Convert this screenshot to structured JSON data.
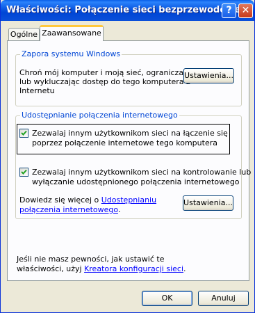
{
  "window": {
    "title": "Właściwości: Połączenie sieci bezprzewodowej",
    "help_glyph": "?",
    "close_glyph": "✕"
  },
  "tabs": [
    {
      "label": "Ogólne",
      "active": false
    },
    {
      "label": "Zaawansowane",
      "active": true
    }
  ],
  "firewall": {
    "group_label": "Zapora systemu Windows",
    "description_lines": [
      "Chroń mój komputer i moją sieć, ograniczając",
      "lub wykluczając dostęp do tego komputera z",
      "Internetu"
    ],
    "settings_button": "Ustawienia..."
  },
  "ics": {
    "group_label": "Udostępnianie połączenia internetowego",
    "option1": {
      "checked": true,
      "lines": [
        "Zezwalaj innym użytkownikom sieci na łączenie się",
        "poprzez połączenie internetowe tego komputera"
      ]
    },
    "option2": {
      "checked": true,
      "lines": [
        "Zezwalaj innym użytkownikom sieci na kontrolowanie lub",
        "wyłączanie udostępnionego połączenia internetowego"
      ]
    },
    "learn_more_prefix": "Dowiedz się więcej o ",
    "learn_more_link_line1": "Udostępnianiu",
    "learn_more_link_line2": "połączenia internetowego",
    "learn_more_suffix": ".",
    "settings_button": "Ustawienia..."
  },
  "footer": {
    "line1": "Jeśli nie masz pewności, jak ustawić te",
    "line2_prefix": "właściwości, użyj ",
    "wizard_link": "Kreatora konfiguracji sieci",
    "line2_suffix": "."
  },
  "buttons": {
    "ok": "OK",
    "cancel": "Anuluj"
  }
}
